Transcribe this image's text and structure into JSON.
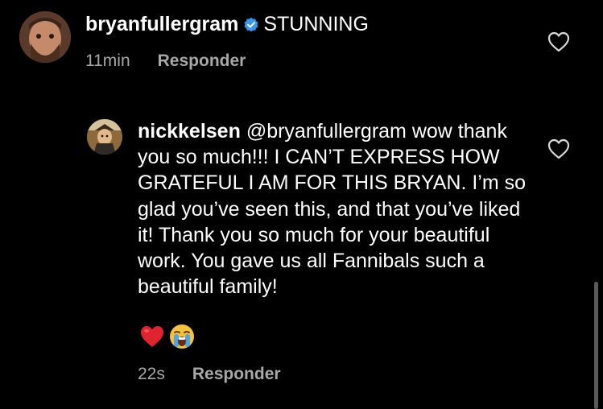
{
  "comments": [
    {
      "username": "bryanfullergram",
      "verified": true,
      "text": "STUNNING",
      "time": "11min",
      "reply_label": "Responder",
      "avatar_icon": "profile-photo-bearded-man",
      "like_icon": "heart-outline-icon"
    }
  ],
  "replies": [
    {
      "username": "nickkelsen",
      "mention": "@bryanfullergram",
      "text": "wow thank you so much!!! I CAN’T EXPRESS HOW GRATEFUL I AM FOR THIS BRYAN. I’m so glad you’ve seen this, and that you’ve liked it! Thank you so much for your beautiful work. You gave us all Fannibals such a beautiful family!",
      "emojis": [
        "❤️",
        "😭"
      ],
      "time": "22s",
      "reply_label": "Responder",
      "avatar_icon": "profile-photo-illustrated-character",
      "like_icon": "heart-outline-icon"
    }
  ],
  "colors": {
    "background": "#000000",
    "text": "#ffffff",
    "secondary_text": "#a8a8a8",
    "verified_badge": "#3897f0",
    "emoji_heart": "#e0242d"
  }
}
